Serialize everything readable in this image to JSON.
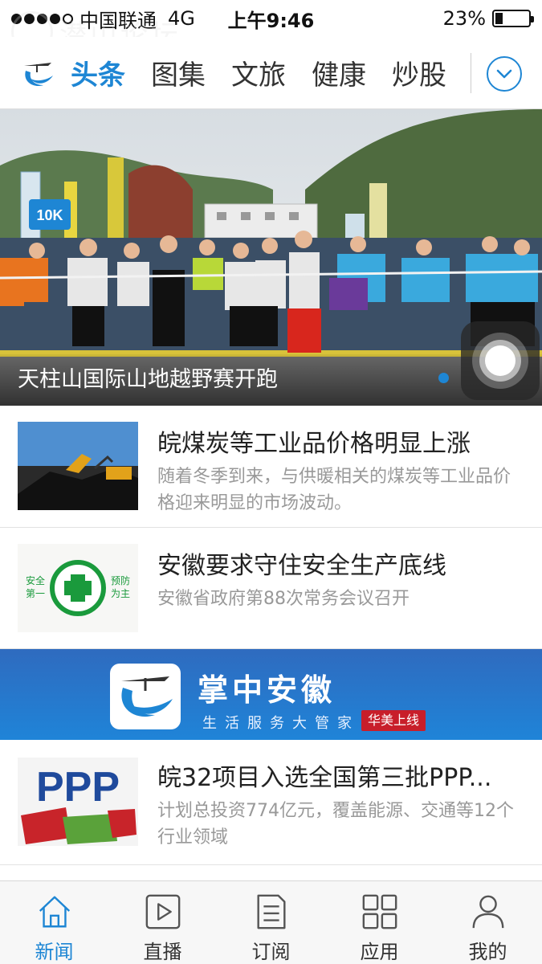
{
  "status_bar": {
    "carrier": "中国联通",
    "network": "4G",
    "time": "上午9:46",
    "battery": "23%",
    "battery_level": 0.23
  },
  "watermark": {
    "text": "潜山论坛"
  },
  "nav": {
    "tabs": [
      {
        "label": "头条",
        "active": true
      },
      {
        "label": "图集",
        "active": false
      },
      {
        "label": "文旅",
        "active": false
      },
      {
        "label": "健康",
        "active": false
      },
      {
        "label": "炒股",
        "active": false
      }
    ],
    "expand_icon": "chevron-down-icon"
  },
  "hero": {
    "caption": "天柱山国际山地越野赛开跑",
    "bib_label": "10K"
  },
  "news": [
    {
      "title": "皖煤炭等工业品价格明显上涨",
      "summary": "随着冬季到来，与供暖相关的煤炭等工业品价格迎来明显的市场波动。"
    },
    {
      "title": "安徽要求守住安全生产底线",
      "summary": "安徽省政府第88次常务会议召开",
      "thumb_left": "安全第一",
      "thumb_right": "预防为主"
    },
    {
      "title": "皖32项目入选全国第三批PPP...",
      "summary": "计划总投资774亿元，覆盖能源、交通等12个行业领域",
      "thumb_text": "PPP"
    }
  ],
  "banner": {
    "title": "掌中安徽",
    "subtitle": "生活服务大管家",
    "badge": "华美上线"
  },
  "tab_bar": {
    "items": [
      {
        "label": "新闻",
        "icon": "home-icon",
        "active": true
      },
      {
        "label": "直播",
        "icon": "play-icon",
        "active": false
      },
      {
        "label": "订阅",
        "icon": "document-icon",
        "active": false
      },
      {
        "label": "应用",
        "icon": "grid-icon",
        "active": false
      },
      {
        "label": "我的",
        "icon": "person-icon",
        "active": false
      }
    ]
  },
  "colors": {
    "accent": "#1e86d4",
    "banner_blue": "#2f6bbf",
    "badge_red": "#c81e2a"
  }
}
